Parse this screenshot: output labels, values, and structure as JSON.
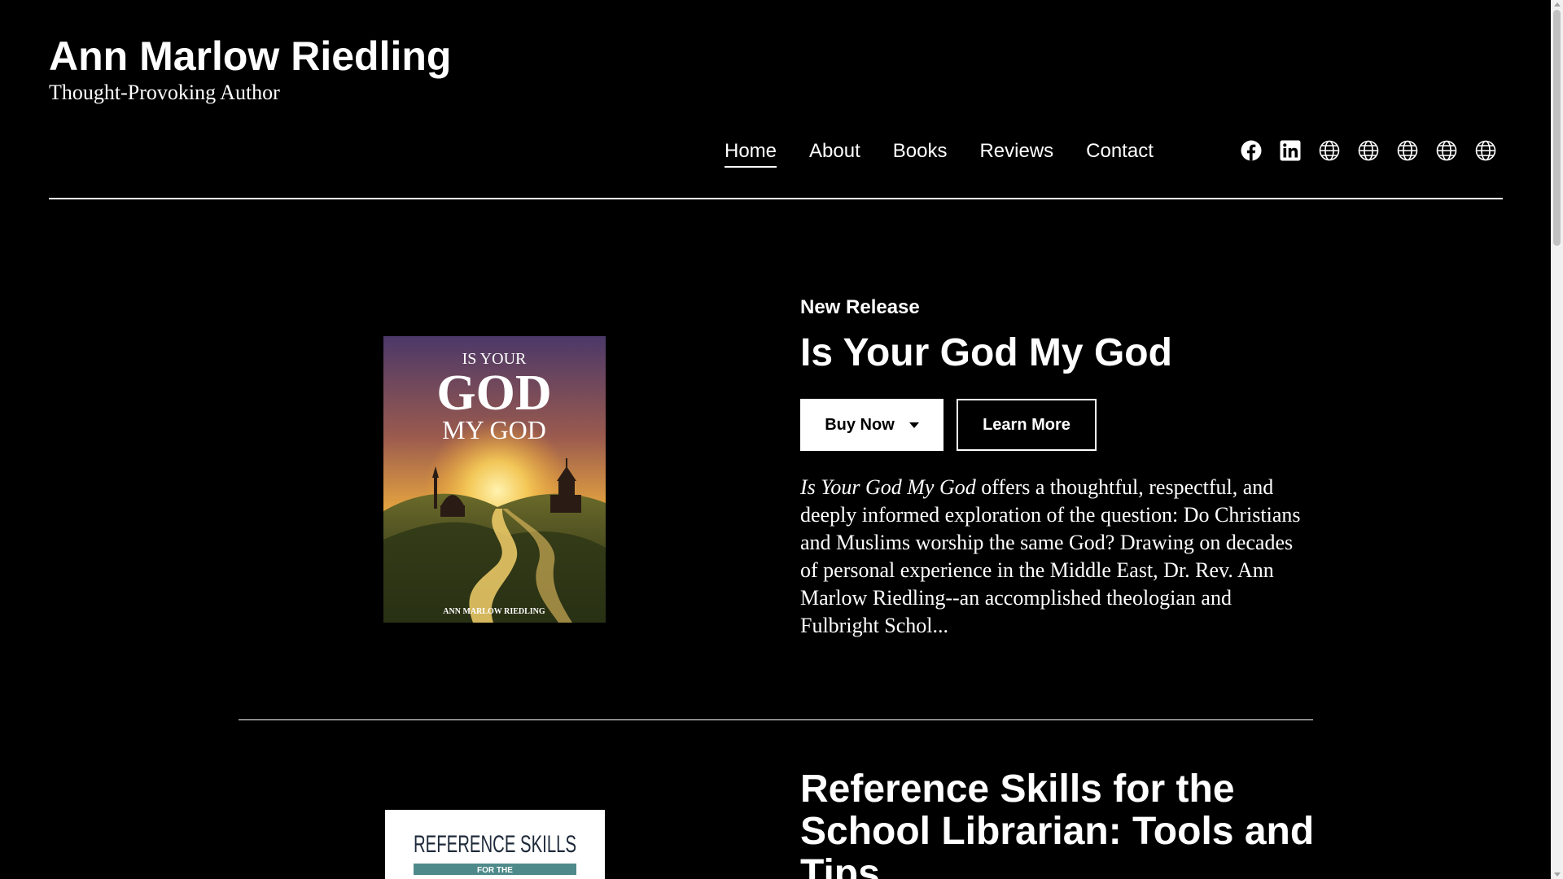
{
  "site": {
    "title": "Ann Marlow Riedling",
    "tagline": "Thought-Provoking Author"
  },
  "nav": {
    "items": [
      "Home",
      "About",
      "Books",
      "Reviews",
      "Contact"
    ],
    "active": "Home"
  },
  "social": [
    "facebook-icon",
    "linkedin-icon",
    "globe-icon",
    "globe-icon",
    "globe-icon",
    "globe-icon",
    "globe-icon"
  ],
  "featured": {
    "eyebrow": "New Release",
    "title": "Is Your God My God",
    "buy_label": "Buy Now",
    "learn_label": "Learn More",
    "description_title": "Is Your God My God",
    "description_rest": " offers a thoughtful, respectful, and deeply informed exploration of the question: Do Christians and Muslims worship the same God? Drawing on decades of personal experience in the Middle East, Dr. Rev. Ann Marlow Riedling--an accomplished theologian and Fulbright Schol...",
    "cover": {
      "line1": "IS YOUR",
      "line2": "GOD",
      "line3": "MY GOD",
      "author": "ANN MARLOW RIEDLING"
    }
  },
  "second": {
    "title": "Reference Skills for the School Librarian: Tools and Tips",
    "cover": {
      "line1": "REFERENCE SKILLS",
      "line2": "FOR THE"
    }
  },
  "colors": {
    "background": "#000000",
    "text": "#ffffff",
    "cover_sky_top": "#5a3b6e",
    "cover_sun": "#f6c44a",
    "cover2_band": "#4f8a8b"
  }
}
